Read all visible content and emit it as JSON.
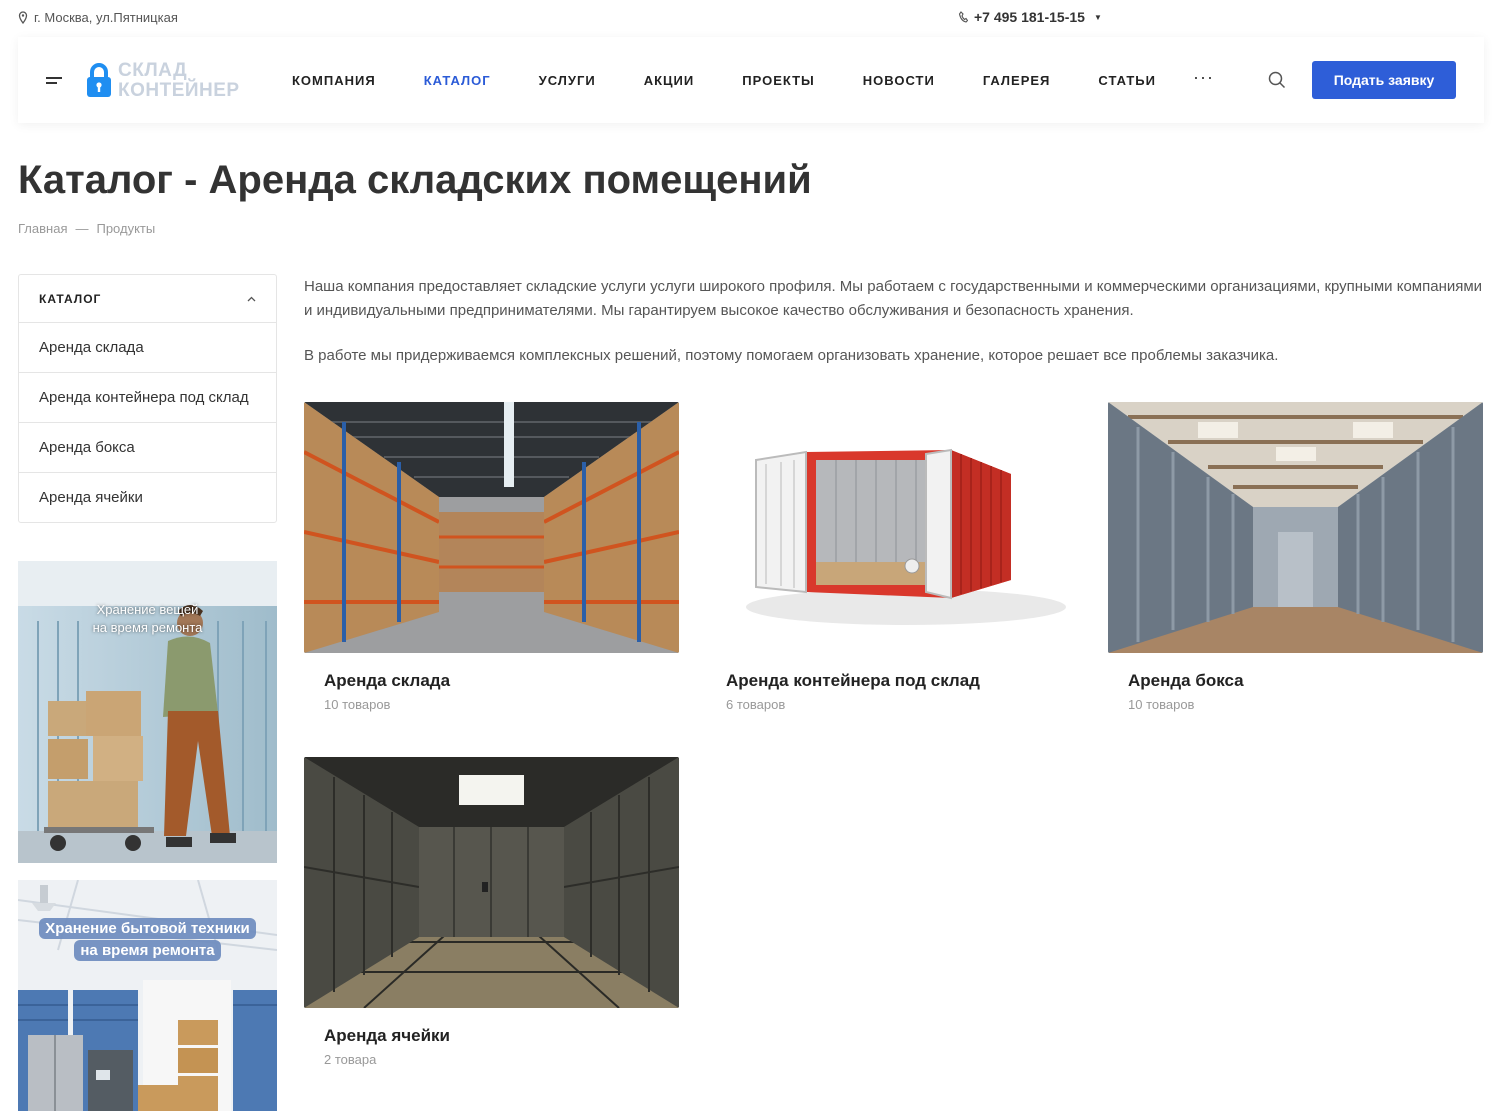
{
  "topbar": {
    "address": "г. Москва, ул.Пятницкая",
    "phone": "+7 495 181-15-15"
  },
  "header": {
    "logo_line1": "СКЛАД",
    "logo_line2": "КОНТЕЙНЕР",
    "nav": [
      "КОМПАНИЯ",
      "КАТАЛОГ",
      "УСЛУГИ",
      "АКЦИИ",
      "ПРОЕКТЫ",
      "НОВОСТИ",
      "ГАЛЕРЕЯ",
      "СТАТЬИ"
    ],
    "more": "···",
    "cta": "Подать заявку",
    "accent": "#2e5ed8"
  },
  "page": {
    "title": "Каталог - Аренда складских помещений",
    "breadcrumbs": {
      "home": "Главная",
      "sep": "—",
      "current": "Продукты"
    }
  },
  "sidebar": {
    "heading": "КАТАЛОГ",
    "items": [
      "Аренда склада",
      "Аренда контейнера под склад",
      "Аренда бокса",
      "Аренда ячейки"
    ],
    "banner1_caption": "Хранение вещей\nна время ремонта",
    "banner2_line1": "Хранение бытовой техники",
    "banner2_line2": "на время ремонта"
  },
  "intro": {
    "p1": "Наша компания предоставляет складские услуги услуги широкого профиля. Мы работаем с государственными и коммерческими организациями, крупными компаниями и индивидуальными предпринимателями. Мы гарантируем высокое качество обслуживания и безопасность хранения.",
    "p2": "В работе мы придерживаемся комплексных решений, поэтому помогаем организовать хранение, которое решает все проблемы заказчика."
  },
  "cards": [
    {
      "title": "Аренда склада",
      "count": "10 товаров"
    },
    {
      "title": "Аренда контейнера под склад",
      "count": "6 товаров"
    },
    {
      "title": "Аренда бокса",
      "count": "10 товаров"
    },
    {
      "title": "Аренда ячейки",
      "count": "2 товара"
    }
  ]
}
